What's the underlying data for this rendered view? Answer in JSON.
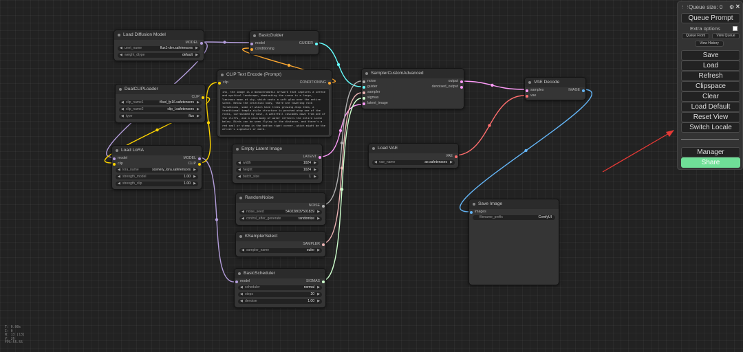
{
  "colors": {
    "model": "#b39ddb",
    "clip": "#ffd500",
    "conditioning": "#ffa931",
    "latent": "#ff9cf9",
    "noise": "#b0b0b0",
    "sampler": "#ecb4b4",
    "sigmas": "#cdffcd",
    "guider": "#66ffff",
    "vae": "#ff6e6e",
    "image": "#64b5f6",
    "accent_share": "#6fdf97",
    "arrow": "#e53935"
  },
  "nodes": {
    "load_diffusion_model": {
      "title": "Load Diffusion Model",
      "output": "MODEL",
      "widgets": [
        {
          "label": "unet_name",
          "value": "flux1-dev.safetensors"
        },
        {
          "label": "weight_dtype",
          "value": "default"
        }
      ]
    },
    "basic_guider": {
      "title": "BasicGuider",
      "inputs": [
        "model",
        "conditioning"
      ],
      "output": "GUIDER"
    },
    "clip_text_encode": {
      "title": "CLIP Text Encode (Prompt)",
      "input": "clip",
      "output": "CONDITIONING",
      "text": "ink, the image is a monochromatic artwork that captures a serene and mystical landscape, dominating the scene is a large, luminous moon at sky, which casts a soft glow over the entire scene. Below the celestial body, there are towering rock formations, some of which have trees growing atop them, a traditional temple-style structure is perched atop one of the rocks, surrounded by mist, a waterfall cascades down from one of the cliffs, and a calm body of water reflects the entire scene below. Birds can be seen flying in the distance, and there's a red seal or stamp in the bottom right corner, which might be the artist's signature or mark."
    },
    "dual_clip_loader": {
      "title": "DualCLIPLoader",
      "output": "CLIP",
      "widgets": [
        {
          "label": "clip_name1",
          "value": "t5xxl_fp16.safetensors"
        },
        {
          "label": "clip_name2",
          "value": "clip_l.safetensors"
        },
        {
          "label": "type",
          "value": "flux"
        }
      ]
    },
    "load_lora": {
      "title": "Load LoRA",
      "inputs": [
        "model",
        "clip"
      ],
      "outputs": [
        "MODEL",
        "CLIP"
      ],
      "widgets": [
        {
          "label": "lora_name",
          "value": "scenery_lora.safetensors"
        },
        {
          "label": "strength_model",
          "value": "1.00"
        },
        {
          "label": "strength_clip",
          "value": "1.00"
        }
      ]
    },
    "sampler_custom_advanced": {
      "title": "SamplerCustomAdvanced",
      "inputs": [
        "noise",
        "guider",
        "sampler",
        "sigmas",
        "latent_image"
      ],
      "outputs": [
        "output",
        "denoised_output"
      ]
    },
    "vae_decode": {
      "title": "VAE Decode",
      "inputs": [
        "samples",
        "vae"
      ],
      "output": "IMAGE"
    },
    "empty_latent": {
      "title": "Empty Latent Image",
      "output": "LATENT",
      "widgets": [
        {
          "label": "width",
          "value": "1024"
        },
        {
          "label": "height",
          "value": "1024"
        },
        {
          "label": "batch_size",
          "value": "1"
        }
      ]
    },
    "load_vae": {
      "title": "Load VAE",
      "output": "VAE",
      "widgets": [
        {
          "label": "vae_name",
          "value": "ae.safetensors"
        }
      ]
    },
    "random_noise": {
      "title": "RandomNoise",
      "output": "NOISE",
      "widgets": [
        {
          "label": "noise_seed",
          "value": "540228037501839"
        },
        {
          "label": "control_after_generate",
          "value": "randomize"
        }
      ]
    },
    "ksampler_select": {
      "title": "KSamplerSelect",
      "output": "SAMPLER",
      "widgets": [
        {
          "label": "sampler_name",
          "value": "euler"
        }
      ]
    },
    "basic_scheduler": {
      "title": "BasicScheduler",
      "input": "model",
      "output": "SIGMAS",
      "widgets": [
        {
          "label": "scheduler",
          "value": "normal"
        },
        {
          "label": "steps",
          "value": "20"
        },
        {
          "label": "denoise",
          "value": "1.00"
        }
      ]
    },
    "save_image": {
      "title": "Save Image",
      "input": "images",
      "widgets": [
        {
          "label": "filename_prefix",
          "value": "ComfyUI"
        }
      ]
    }
  },
  "menu": {
    "queue_size": "Queue size: 0",
    "queue_prompt": "Queue Prompt",
    "extra_options": "Extra options",
    "queue_front": "Queue Front",
    "view_queue": "View Queue",
    "view_history": "View History",
    "buttons": [
      "Save",
      "Load",
      "Refresh",
      "Clipspace",
      "Clear",
      "Load Default",
      "Reset View",
      "Switch Locale"
    ],
    "manager": "Manager",
    "share": "Share"
  },
  "stats": [
    "T: 0.00s",
    "I: 0",
    "N: 13 [13]",
    "V: 26",
    "FPS:55.55"
  ]
}
